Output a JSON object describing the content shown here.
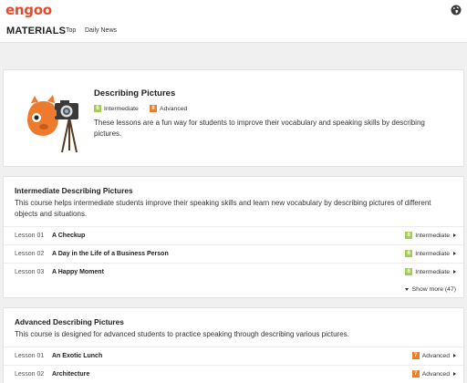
{
  "header": {
    "logo": "engoo",
    "globe_icon": "globe-icon"
  },
  "subnav": {
    "brand": "MATERIALS",
    "links": [
      "Top",
      "Daily News"
    ]
  },
  "hero": {
    "title": "Describing Pictures",
    "levels": [
      {
        "badge": "6",
        "label": "Intermediate"
      },
      {
        "badge": "8",
        "label": "Advanced"
      }
    ],
    "description": "These lessons are a fun way for students to improve their vocabulary and speaking skills by describing pictures.",
    "illustration_icon": "mascot-camera-icon"
  },
  "courses": [
    {
      "title": "Intermediate Describing Pictures",
      "description": "This course helps intermediate students improve their speaking skills and learn new vocabulary by describing pictures of different objects and situations.",
      "lessons": [
        {
          "num": "Lesson 01",
          "name": "A Checkup",
          "badge": "6",
          "level": "Intermediate"
        },
        {
          "num": "Lesson 02",
          "name": "A Day in the Life of a Business Person",
          "badge": "6",
          "level": "Intermediate"
        },
        {
          "num": "Lesson 03",
          "name": "A Happy Moment",
          "badge": "6",
          "level": "Intermediate"
        }
      ],
      "show_more": "Show more (47)"
    },
    {
      "title": "Advanced Describing Pictures",
      "description": "This course is designed for advanced students to practice speaking through describing various pictures.",
      "lessons": [
        {
          "num": "Lesson 01",
          "name": "An Exotic Lunch",
          "badge": "7",
          "level": "Advanced"
        },
        {
          "num": "Lesson 02",
          "name": "Architecture",
          "badge": "7",
          "level": "Advanced"
        }
      ]
    }
  ],
  "colors": {
    "brand": "#e8492a",
    "intermediate": "#a6cd56",
    "advanced": "#ec7d2c",
    "background": "#f0f0f0"
  }
}
